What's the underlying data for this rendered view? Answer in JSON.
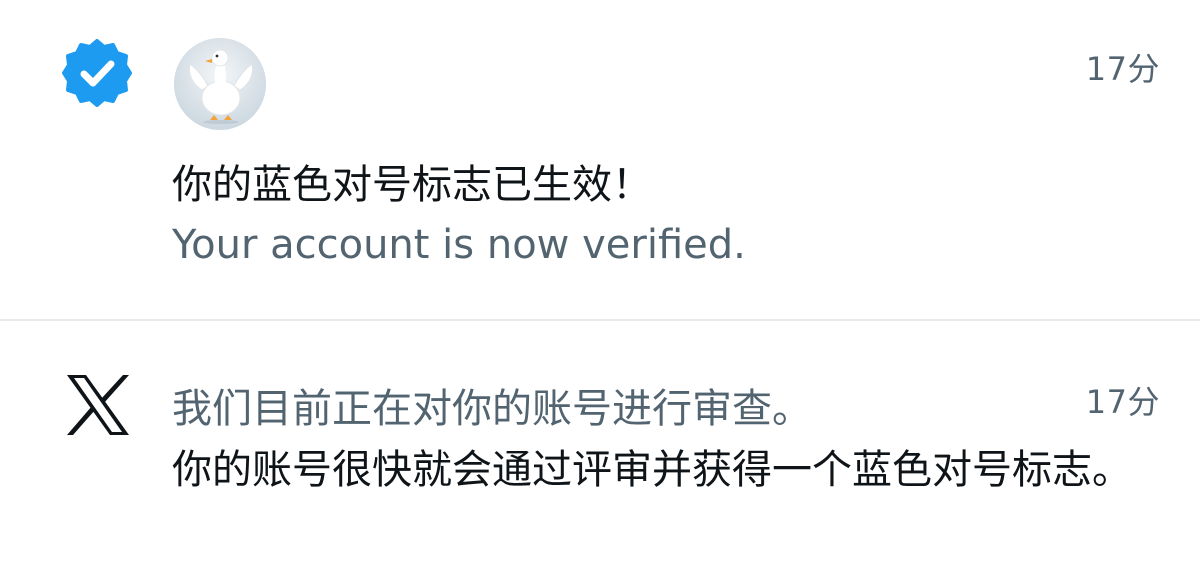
{
  "notifications": [
    {
      "type": "verified",
      "icon": "verified-badge-icon",
      "avatar": "duck-avatar",
      "time": "17分",
      "title": "你的蓝色对号标志已生效！",
      "subtitle": "Your account is now verified.",
      "accent_color": "#1d9bf0"
    },
    {
      "type": "review",
      "icon": "x-logo-icon",
      "time": "17分",
      "title": "我们目前正在对你的账号进行审查。",
      "body": "你的账号很快就会通过评审并获得一个蓝色对号标志。"
    }
  ]
}
